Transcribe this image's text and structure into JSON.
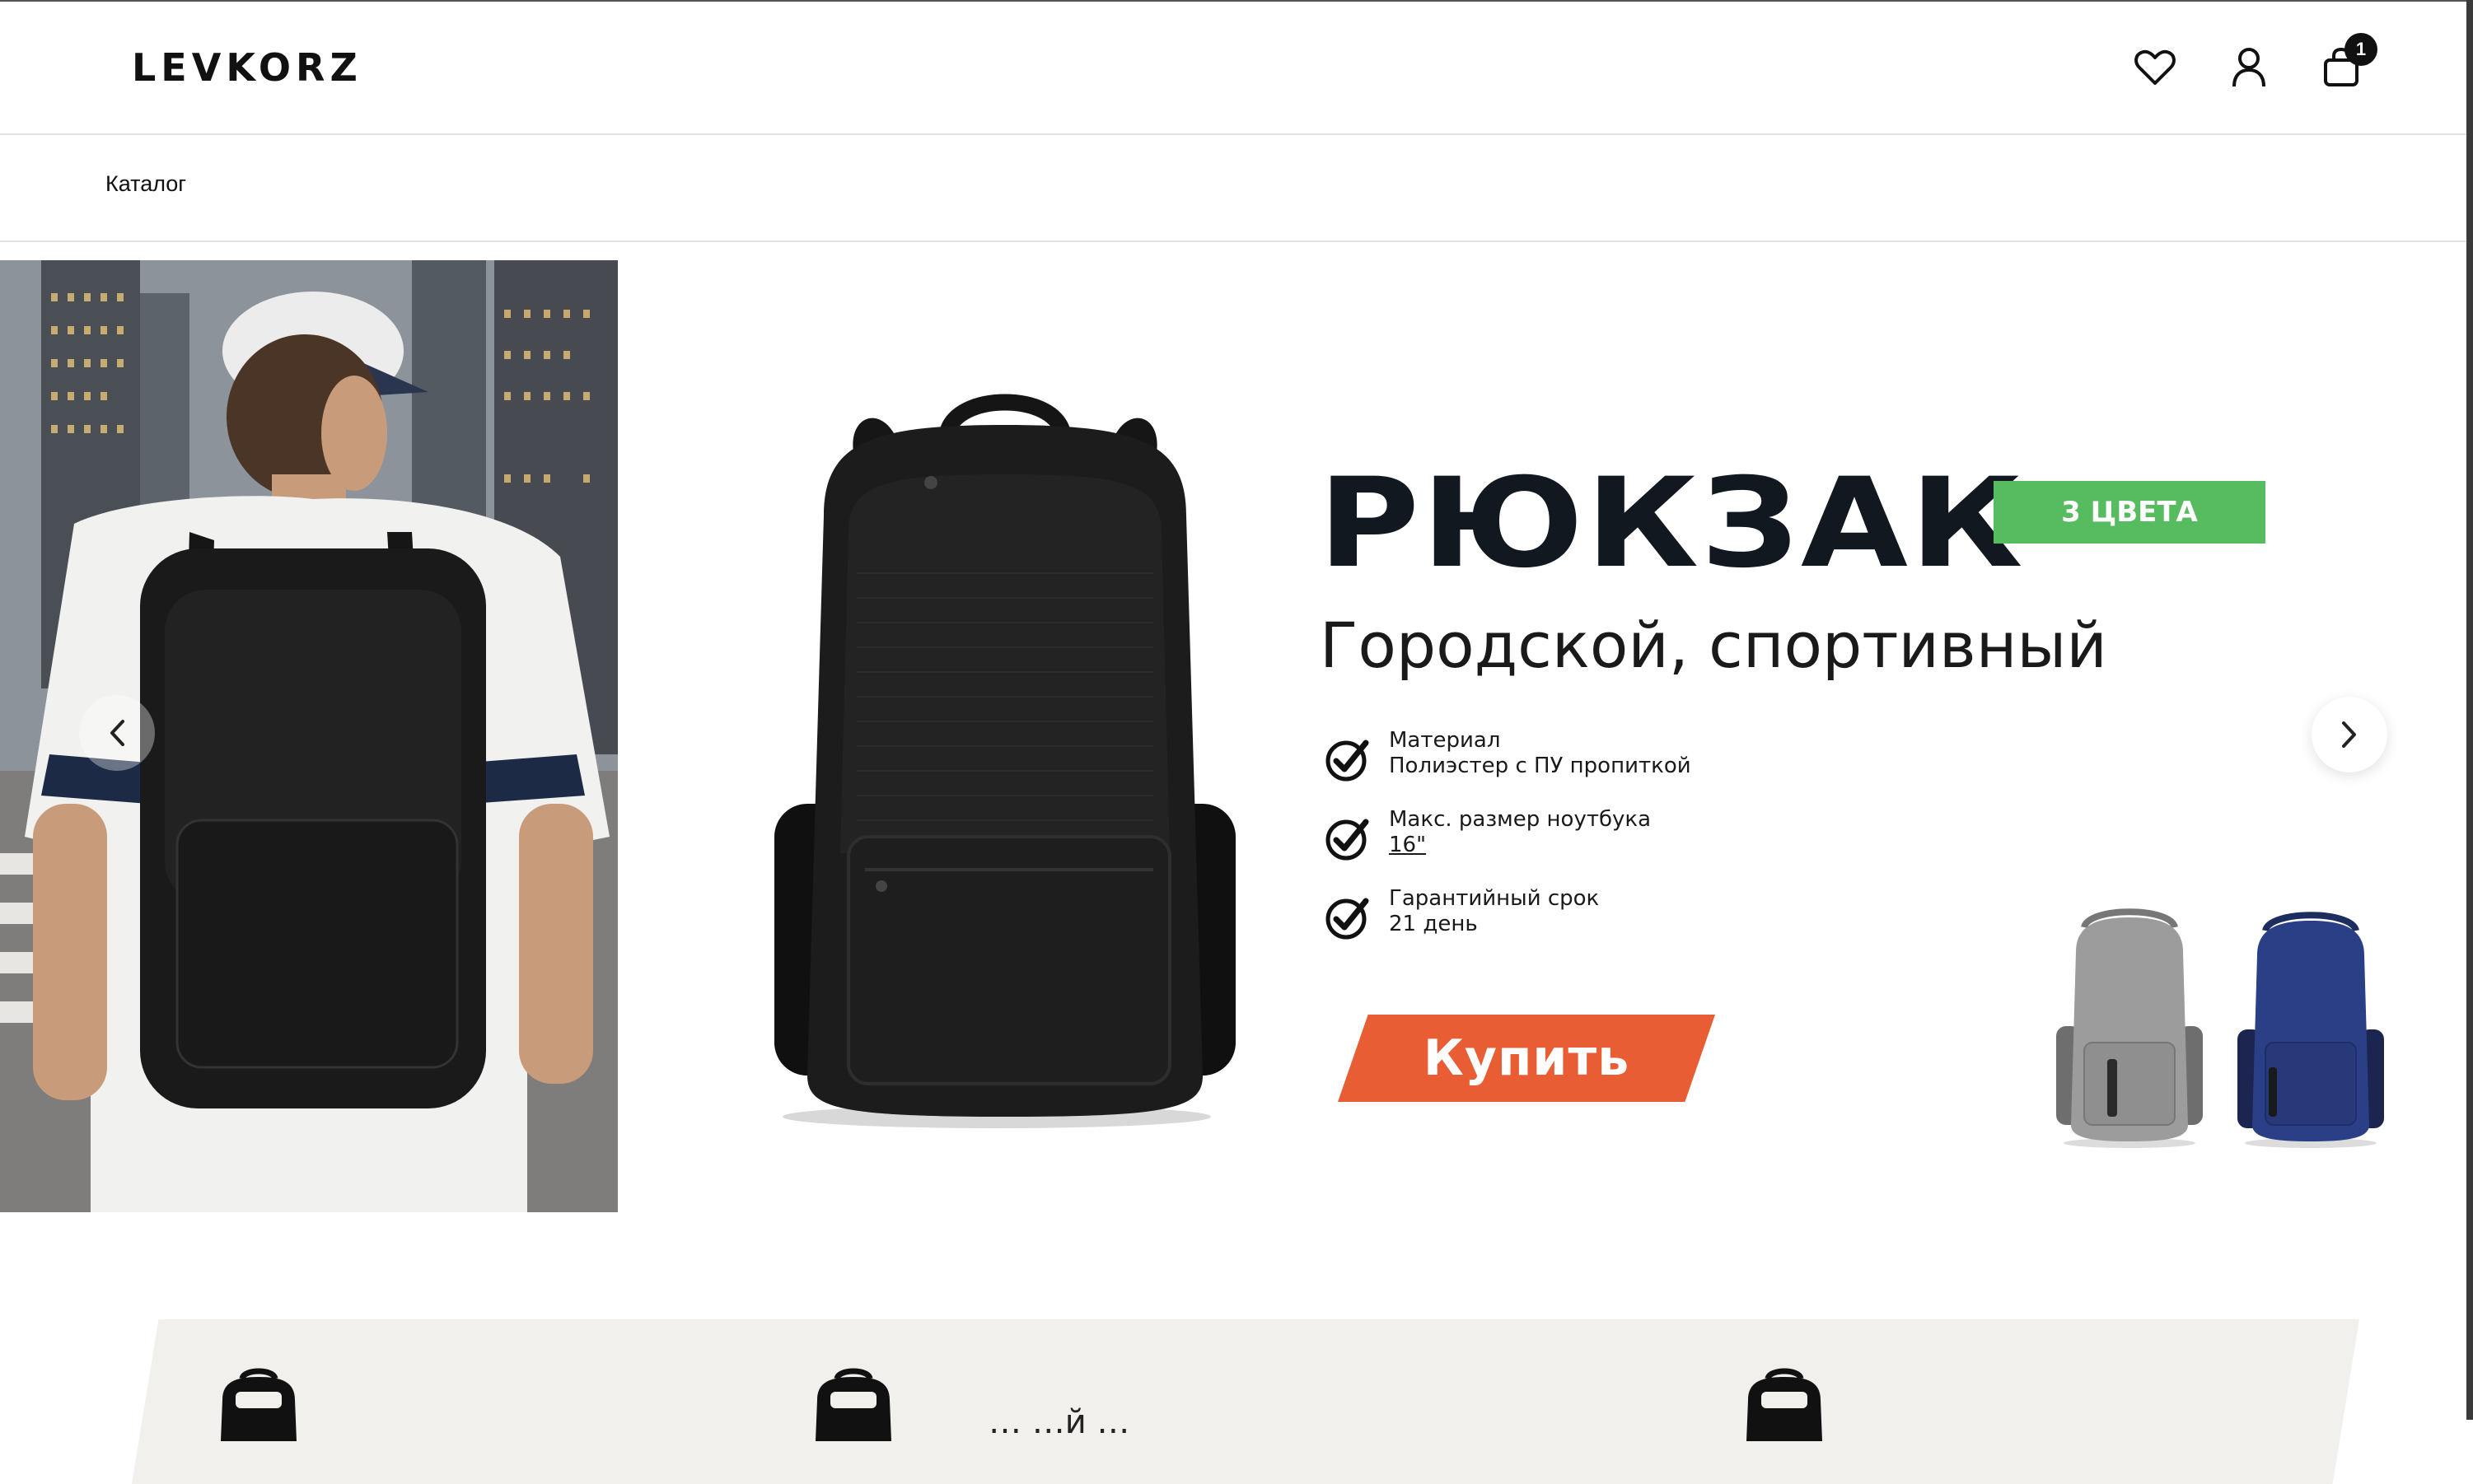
{
  "header": {
    "logo": "LEVKORZ",
    "icons": [
      "heart-icon",
      "user-icon",
      "shopping-bag-icon"
    ],
    "cart_count": "1"
  },
  "nav": {
    "catalog_label": "Каталог"
  },
  "hero": {
    "title": "РЮКЗАК",
    "colors_badge": "3 ЦВЕТА",
    "subtitle": "Городской, спортивный",
    "features": [
      {
        "label": "Материал",
        "value": "Полиэстер с ПУ пропиткой"
      },
      {
        "label": "Макс. размер ноутбука",
        "value": "16\""
      },
      {
        "label": "Гарантийный срок",
        "value": "21 день"
      }
    ],
    "buy_label": "Купить",
    "colors": {
      "accent_orange": "#e85d34",
      "badge_green": "#57bb5f",
      "title_dark": "#111820"
    },
    "variants": [
      "grey",
      "navy blue"
    ]
  },
  "benefits": {
    "items": [
      {
        "text": ""
      },
      {
        "text": "… …й …"
      },
      {
        "text": ""
      }
    ]
  }
}
